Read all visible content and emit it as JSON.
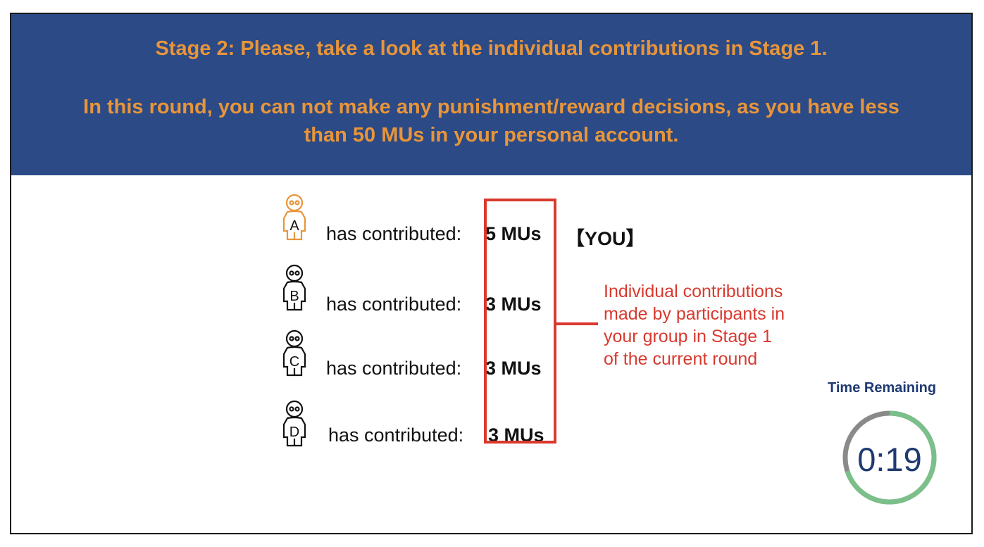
{
  "header": {
    "title": "Stage 2: Please, take a look at the individual contributions in Stage 1.",
    "message": "In this round, you can not make any punishment/reward decisions, as you have less than 50 MUs in your personal account."
  },
  "participants": [
    {
      "letter": "A",
      "label": "has contributed:",
      "value": "5 MUs",
      "tag": "【YOU】",
      "color": "#e8953a"
    },
    {
      "letter": "B",
      "label": "has contributed:",
      "value": "3 MUs",
      "tag": "",
      "color": "#111111"
    },
    {
      "letter": "C",
      "label": "has contributed:",
      "value": "3 MUs",
      "tag": "",
      "color": "#111111"
    },
    {
      "letter": "D",
      "label": "has contributed:",
      "value": "3 MUs",
      "tag": "",
      "color": "#111111"
    }
  ],
  "annotation": {
    "lines": [
      "Individual contributions",
      "made by participants in",
      "your group in Stage 1",
      "of the current round"
    ]
  },
  "timer": {
    "title": "Time Remaining",
    "value": "0:19",
    "remaining_fraction": 0.7,
    "ring_color": "#7bbf8a",
    "track_color": "#8a8a8a"
  },
  "colors": {
    "banner_bg": "#2b4a86",
    "banner_text": "#e8953a",
    "highlight": "#d9392e"
  }
}
